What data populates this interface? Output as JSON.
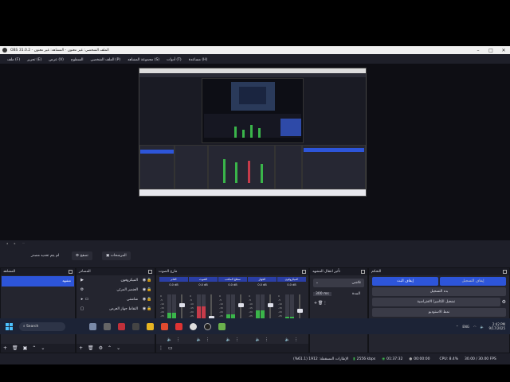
{
  "window": {
    "title": "OBS 31.0.2 - الملف الشخصي: غير معنون - المشاهد: غير معنون"
  },
  "menu": [
    "ملف (F)",
    "تحرير (E)",
    "عرض (V)",
    "السطوح",
    "الملف الشخصي (P)",
    "مجموعة المشاهد (S)",
    "أدوات (T)",
    "مساعدة (H)"
  ],
  "transport": {
    "studio_mode": "استديو عرض",
    "edit": "تصفح",
    "filters": "المرشحات",
    "no_source": "لم يتم تحديد مصدر"
  },
  "scenes": {
    "title": "المشاهد",
    "items": [
      "مشهد"
    ]
  },
  "sources": {
    "title": "المصادر",
    "items": [
      {
        "label": "الميكروفون",
        "icon": "play-icon"
      },
      {
        "label": "العنصر المرئي",
        "icon": "gear-icon"
      },
      {
        "label": "شاشتي",
        "icon": "display-icon"
      },
      {
        "label": "التقاط جهاز العرض",
        "icon": "monitor-icon"
      }
    ]
  },
  "mixer": {
    "title": "مازج الصوت",
    "strips": [
      {
        "name": "العام",
        "db": "0.0 dB",
        "level": 0.55,
        "fader": 0.75,
        "color": "#3ab54a"
      },
      {
        "name": "الصوت",
        "db": "0.0 dB",
        "level": 0.7,
        "fader": 0.4,
        "color": "#c63b4a"
      },
      {
        "name": "سطح المكتب",
        "db": "0.0 dB",
        "level": 0.5,
        "fader": 0.75,
        "color": "#3ab54a"
      },
      {
        "name": "الجهاز",
        "db": "0.0 dB",
        "level": 0.6,
        "fader": 0.75,
        "color": "#3ab54a"
      },
      {
        "name": "الميكروفون",
        "db": "0.0 dB",
        "level": 0.45,
        "fader": 0.6,
        "color": "#3ab54a"
      }
    ],
    "scale": [
      "0",
      "-5",
      "-10",
      "-15",
      "-20",
      "-25",
      "-30",
      "-35",
      "-40",
      "-45",
      "-50",
      "-55",
      "-60"
    ]
  },
  "transitions": {
    "title": "تأثير انتقال المشهد",
    "selected": "تلاشي",
    "duration_label": "المدة",
    "duration_value": "300 ms"
  },
  "controls": {
    "title": "التحكم",
    "buttons": [
      "إيقاف البث",
      "إيقاف التسجيل",
      "بدء التسجيل",
      "تشغيل الكاميرا الافتراضية",
      "نمط الاستوديو",
      "إعدادات",
      "خروج"
    ]
  },
  "status": {
    "frames": "الإطارات المسقطة: 1912 (61.1%)",
    "bitrate": "2556 kbps",
    "stream_time": "01:37:32",
    "rec_time": "00:00:00",
    "cpu": "CPU: 8.4%",
    "fps": "30.00 / 30.00 FPS"
  },
  "taskbar": {
    "search": "Search",
    "lang": "ENG",
    "time": "2:42 PM",
    "date": "9/17/2025"
  }
}
